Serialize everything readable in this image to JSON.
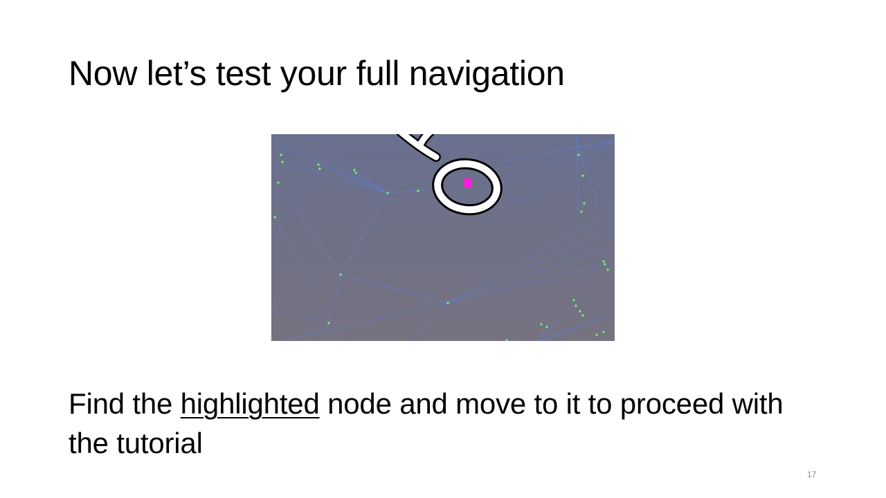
{
  "slide": {
    "title": "Now let’s test your full navigation",
    "body": {
      "before": "Find the ",
      "highlight": "highlighted",
      "after": " node and move to it to proceed with the tutorial"
    },
    "slide_number": "17"
  },
  "graph_view": {
    "background_color": "#6d7189",
    "edge_color": "#5f7fd6",
    "node_color": "#6cff6c",
    "highlighted_node_color": "#ff1fd7",
    "cursor_icon": "cursor-ring-icon"
  }
}
